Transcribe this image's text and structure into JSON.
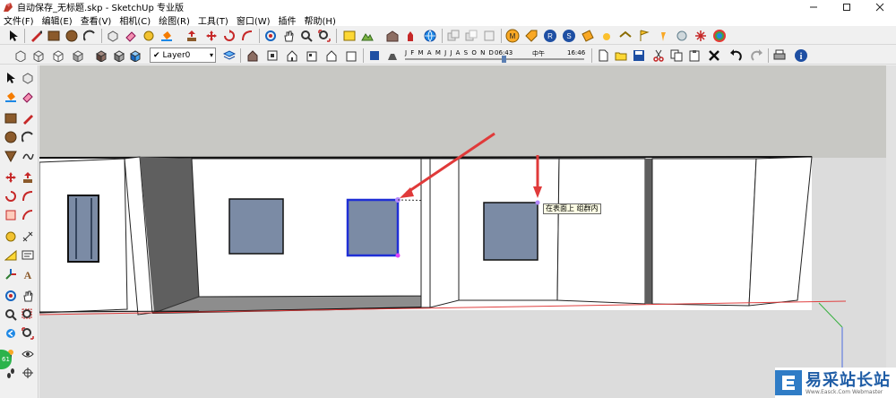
{
  "window": {
    "title": "自动保存_无标题.skp - SketchUp 专业版",
    "controls": [
      "minimize",
      "maximize",
      "close"
    ]
  },
  "menu": {
    "items": [
      "文件(F)",
      "编辑(E)",
      "查看(V)",
      "相机(C)",
      "绘图(R)",
      "工具(T)",
      "窗口(W)",
      "插件",
      "帮助(H)"
    ]
  },
  "toolbar": {
    "layer_label": "Layer0",
    "shadow_months": "J F M A M J J A S O N D",
    "shadow_time_start": "06:43",
    "shadow_time_mid": "中午",
    "shadow_time_end": "16:46",
    "shadow_position": 0.55
  },
  "tooltip": {
    "text": "在表面上  组群内"
  },
  "status": {
    "badge": "61"
  },
  "watermark": {
    "title": "易采站长站",
    "subtitle": "Www.Easck.Com Webmaster"
  },
  "colors": {
    "sky": "#c8c8c4",
    "ground": "#dcdcdc",
    "wall": "#ffffff",
    "window_fill": "#7b8ba5",
    "selection": "#1f2fd6",
    "arrow": "#e03a3a",
    "axis_red": "#e04040",
    "axis_green": "#38b040",
    "axis_blue": "#4b6be0",
    "shadow": "#5f5f5f"
  }
}
